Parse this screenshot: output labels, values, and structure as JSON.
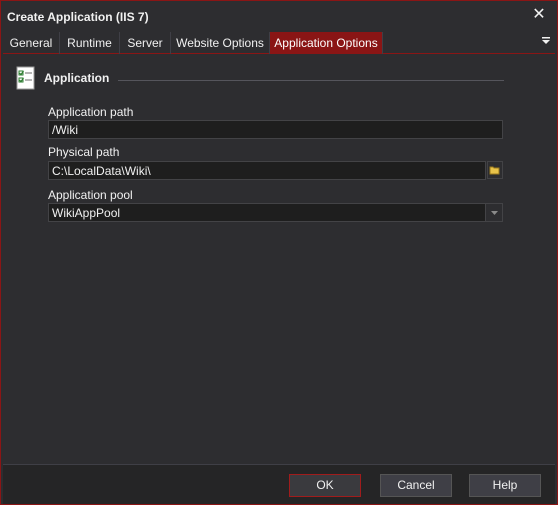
{
  "window": {
    "title": "Create Application (IIS 7)",
    "close_glyph": "✕"
  },
  "tabs": [
    {
      "label": "General"
    },
    {
      "label": "Runtime"
    },
    {
      "label": "Server"
    },
    {
      "label": "Website Options"
    },
    {
      "label": "Application Options",
      "active": true
    }
  ],
  "section": {
    "title": "Application"
  },
  "fields": {
    "app_path": {
      "label": "Application path",
      "value": "/Wiki"
    },
    "physical_path": {
      "label": "Physical path",
      "value": "C:\\LocalData\\Wiki\\"
    },
    "app_pool": {
      "label": "Application pool",
      "value": "WikiAppPool"
    }
  },
  "buttons": {
    "ok": "OK",
    "cancel": "Cancel",
    "help": "Help"
  },
  "colors": {
    "accent": "#8a1515",
    "background": "#2d2d30",
    "field_bg": "#1e1e1e"
  }
}
